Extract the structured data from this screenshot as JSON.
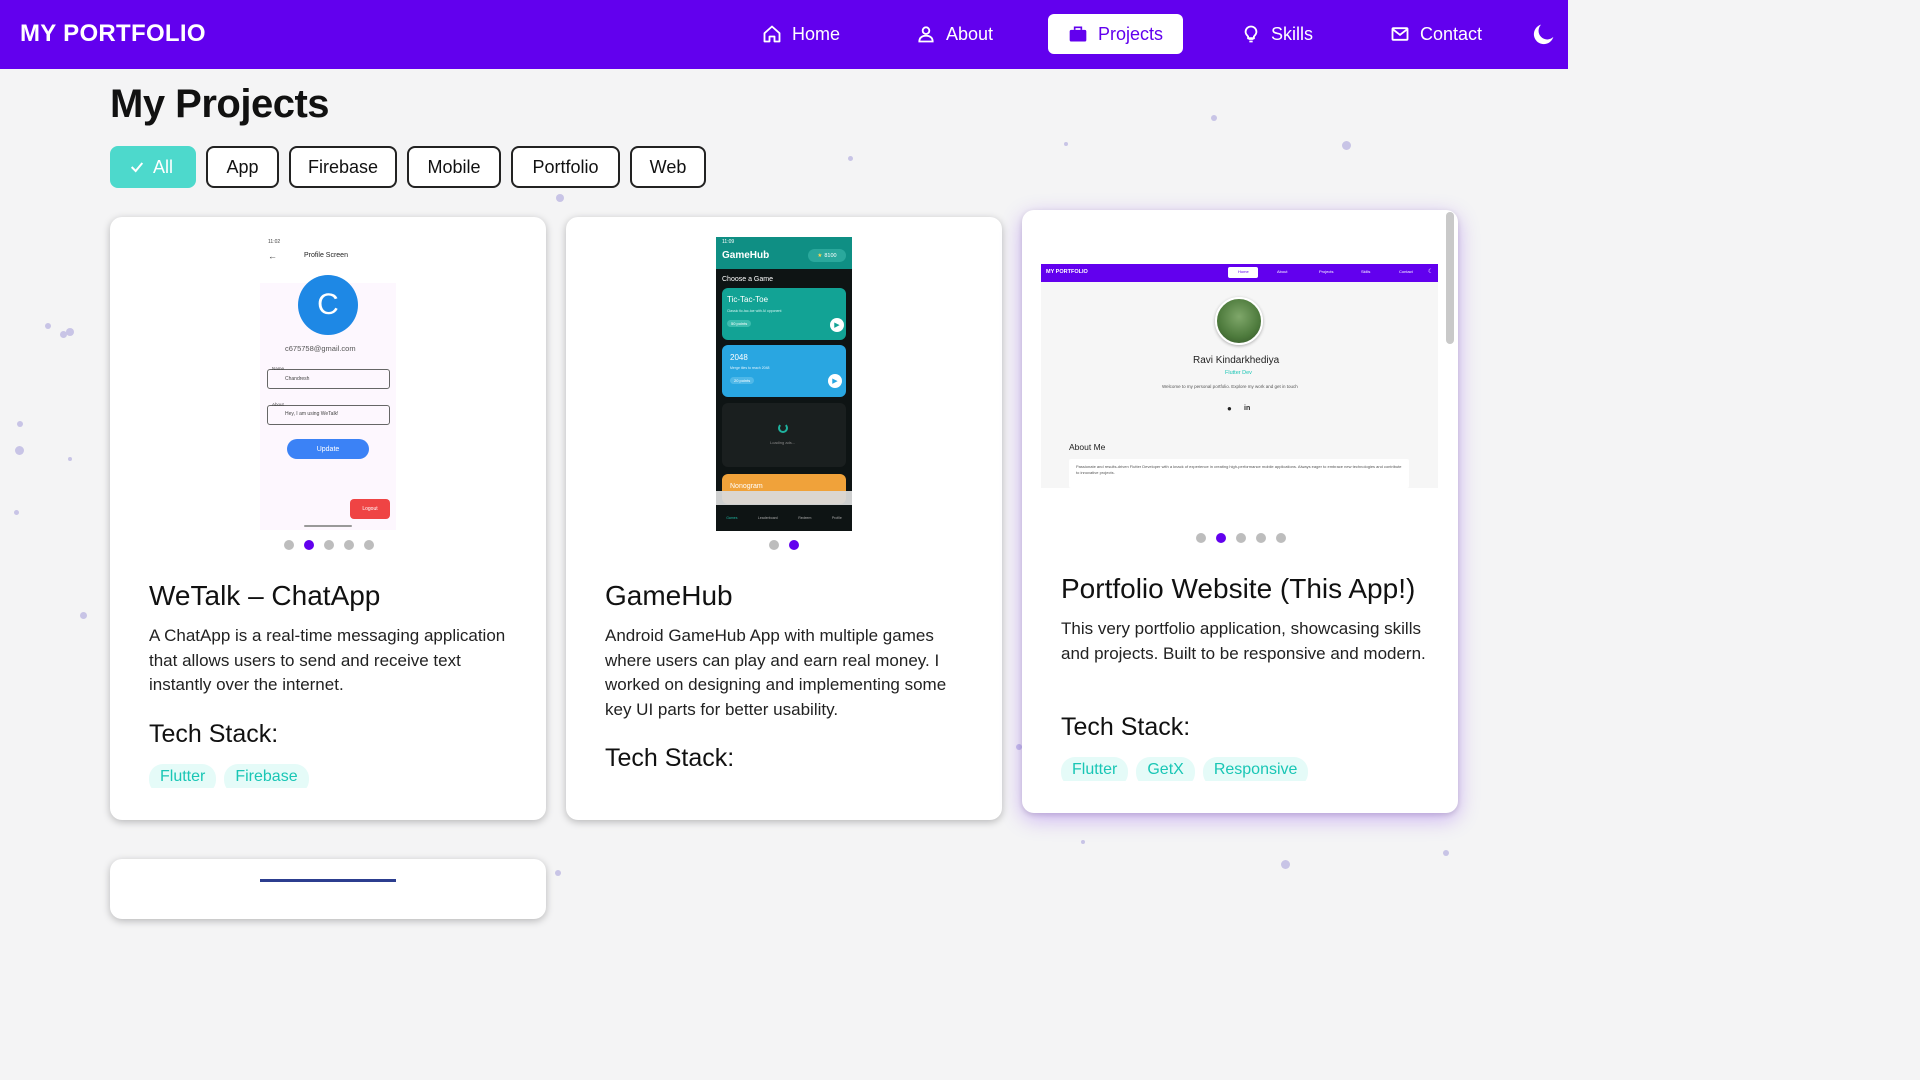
{
  "brand": "MY PORTFOLIO",
  "nav": {
    "items": [
      {
        "label": "Home",
        "icon": "home-icon"
      },
      {
        "label": "About",
        "icon": "person-icon"
      },
      {
        "label": "Projects",
        "icon": "briefcase-icon",
        "active": true
      },
      {
        "label": "Skills",
        "icon": "lightbulb-icon"
      },
      {
        "label": "Contact",
        "icon": "mail-icon"
      }
    ],
    "theme_toggle_icon": "moon-icon"
  },
  "page_title": "My Projects",
  "filters": {
    "selected": "All",
    "chips": [
      "All",
      "App",
      "Firebase",
      "Mobile",
      "Portfolio",
      "Web"
    ]
  },
  "projects": [
    {
      "title": "WeTalk – ChatApp",
      "description": "A ChatApp is a real-time messaging application that allows users to send and receive text instantly over the internet.",
      "tech_label": "Tech Stack:",
      "tags": [
        "Flutter",
        "Firebase"
      ],
      "carousel": {
        "count": 5,
        "active": 2
      },
      "preview": {
        "status_left": "11:02",
        "screen_title": "Profile Screen",
        "avatar_letter": "C",
        "email": "c675758@gmail.com",
        "name_label": "Name",
        "name_value": "Chandresh",
        "about_label": "About",
        "about_value": "Hey, I am using WeTalk!",
        "update_button": "Update",
        "logout_button": "Logout"
      }
    },
    {
      "title": "GameHub",
      "description": "Android GameHub App with multiple games where users can play and earn real money. I worked on designing and implementing some key UI parts for better usability.",
      "tech_label": "Tech Stack:",
      "tags": [],
      "carousel": {
        "count": 2,
        "active": 2
      },
      "preview": {
        "time": "11:09",
        "app_title": "GameHub",
        "coins": "8100",
        "section": "Choose a Game",
        "games": [
          {
            "name": "Tic-Tac-Toe",
            "desc": "Classic tic-tac-toe with AI opponent",
            "points": "50 points"
          },
          {
            "name": "2048",
            "desc": "Merge tiles to reach 2048",
            "points": "20 points"
          }
        ],
        "loading": "Loading ads...",
        "partial_game": "Nonogram",
        "tabs": [
          "Games",
          "Leaderboard",
          "Redeem",
          "Profile"
        ]
      }
    },
    {
      "title": "Portfolio Website (This App!)",
      "description": "This very portfolio application, showcasing skills and projects. Built to be responsive and modern.",
      "tech_label": "Tech Stack:",
      "tags": [
        "Flutter",
        "GetX",
        "Responsive"
      ],
      "carousel": {
        "count": 5,
        "active": 2
      },
      "preview": {
        "brand": "MY PORTFOLIO",
        "nav": [
          "Home",
          "About",
          "Projects",
          "Skills",
          "Contact"
        ],
        "name": "Ravi Kindarkhediya",
        "role": "Flutter Dev",
        "welcome": "Welcome to my personal portfolio. Explore my work and get in touch",
        "about_heading": "About Me",
        "about_text": "Passionate and results-driven Flutter Developer with a knack of experience in creating high-performance mobile applications. Always eager to embrace new technologies and contribute to innovative projects."
      }
    }
  ],
  "colors": {
    "primary": "#6200ee",
    "accent": "#4dd9cc",
    "tag_text": "#19c6b5",
    "background": "#f4f4f5"
  }
}
